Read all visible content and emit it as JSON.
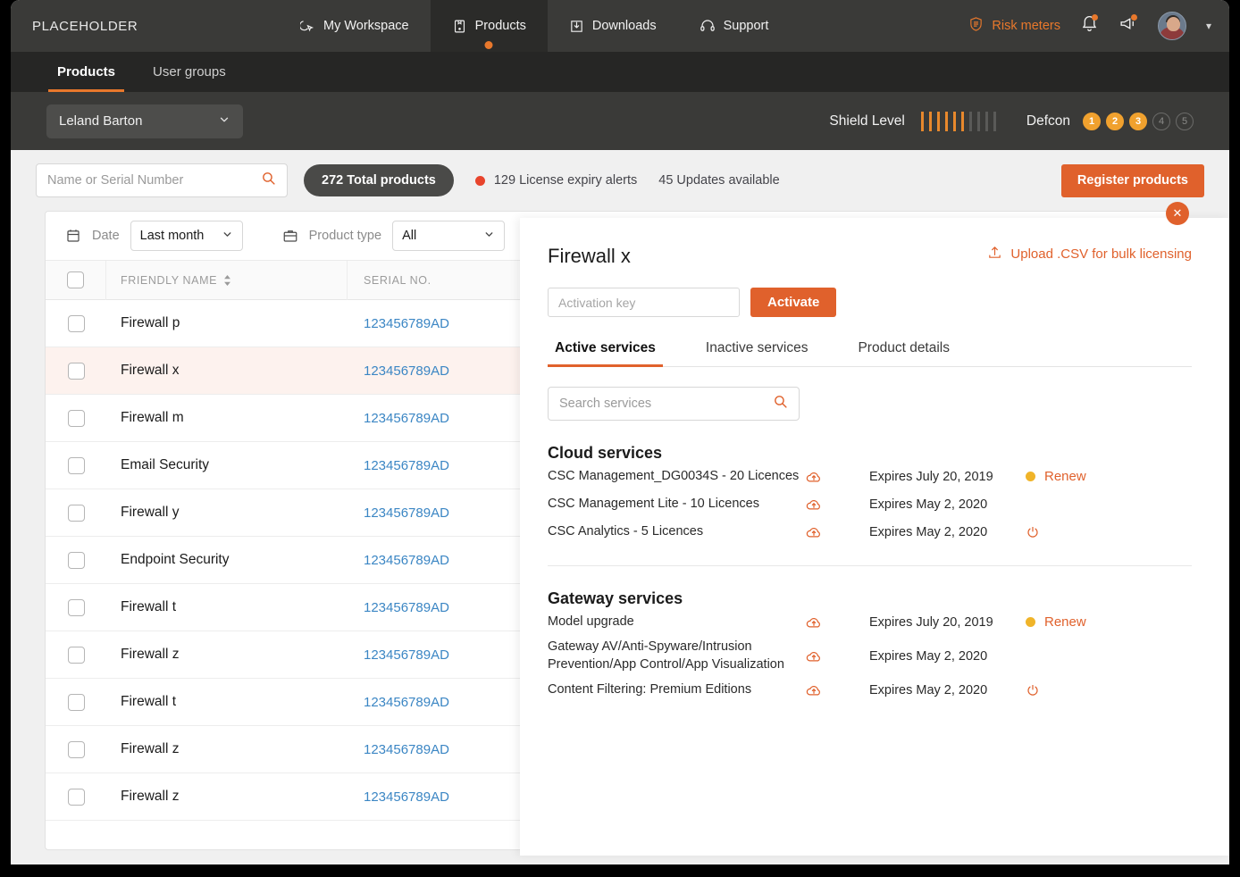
{
  "topnav": {
    "brand": "PLACEHOLDER",
    "items": [
      {
        "label": "My Workspace",
        "icon": "cursor-icon",
        "active": false
      },
      {
        "label": "Products",
        "icon": "package-icon",
        "active": true
      },
      {
        "label": "Downloads",
        "icon": "download-icon",
        "active": false
      },
      {
        "label": "Support",
        "icon": "headset-icon",
        "active": false
      }
    ],
    "risk_meters": "Risk meters",
    "icons": [
      "bell-icon",
      "megaphone-icon",
      "avatar",
      "chevron-down-icon"
    ]
  },
  "subnav": {
    "tabs": [
      {
        "label": "Products",
        "active": true
      },
      {
        "label": "User groups",
        "active": false
      }
    ]
  },
  "userband": {
    "user": "Leland Barton",
    "shield_label": "Shield Level",
    "shield_filled": 6,
    "shield_total": 10,
    "defcon_label": "Defcon",
    "defcon_levels": [
      "1",
      "2",
      "3",
      "4",
      "5"
    ],
    "defcon_active": 3
  },
  "toolbar": {
    "search_placeholder": "Name or Serial Number",
    "search_value": "",
    "total_products": "272 Total products",
    "expiry_alerts": "129 License expiry alerts",
    "updates_available": "45 Updates available",
    "register_label": "Register products"
  },
  "filters": {
    "date_label": "Date",
    "date_value": "Last month",
    "product_type_label": "Product type",
    "product_type_value": "All"
  },
  "table": {
    "columns": [
      "FRIENDLY NAME",
      "SERIAL NO."
    ],
    "rows": [
      {
        "name": "Firewall p",
        "serial": "123456789AD",
        "selected": false,
        "alert": false
      },
      {
        "name": "Firewall x",
        "serial": "123456789AD",
        "selected": true,
        "alert": true
      },
      {
        "name": "Firewall m",
        "serial": "123456789AD",
        "selected": false,
        "alert": false
      },
      {
        "name": "Email Security",
        "serial": "123456789AD",
        "selected": false,
        "alert": false
      },
      {
        "name": "Firewall y",
        "serial": "123456789AD",
        "selected": false,
        "alert": false
      },
      {
        "name": "Endpoint Security",
        "serial": "123456789AD",
        "selected": false,
        "alert": false
      },
      {
        "name": "Firewall t",
        "serial": "123456789AD",
        "selected": false,
        "alert": false
      },
      {
        "name": "Firewall z",
        "serial": "123456789AD",
        "selected": false,
        "alert": false
      },
      {
        "name": "Firewall t",
        "serial": "123456789AD",
        "selected": false,
        "alert": false
      },
      {
        "name": "Firewall z",
        "serial": "123456789AD",
        "selected": false,
        "alert": false
      },
      {
        "name": "Firewall z",
        "serial": "123456789AD",
        "selected": false,
        "alert": false
      }
    ]
  },
  "panel": {
    "title": "Firewall x",
    "upload_link": "Upload .CSV for bulk licensing",
    "activation_placeholder": "Activation key",
    "activation_value": "",
    "activate_label": "Activate",
    "tabs": [
      {
        "label": "Active services",
        "active": true
      },
      {
        "label": "Inactive services",
        "active": false
      },
      {
        "label": "Product details",
        "active": false
      }
    ],
    "search_placeholder": "Search services",
    "search_value": "",
    "groups": [
      {
        "title": "Cloud services",
        "services": [
          {
            "name": "CSC Management_DG0034S - 20 Licences",
            "expiry": "Expires July 20, 2019",
            "status": "renew",
            "action": "Renew"
          },
          {
            "name": "CSC Management Lite - 10 Licences",
            "expiry": "Expires May 2, 2020",
            "status": "none",
            "action": ""
          },
          {
            "name": "CSC Analytics - 5 Licences",
            "expiry": "Expires May 2, 2020",
            "status": "power",
            "action": ""
          }
        ]
      },
      {
        "title": "Gateway services",
        "services": [
          {
            "name": "Model upgrade",
            "expiry": "Expires July 20, 2019",
            "status": "renew",
            "action": "Renew"
          },
          {
            "name": "Gateway AV/Anti-Spyware/Intrusion Prevention/App Control/App Visualization",
            "expiry": "Expires May 2, 2020",
            "status": "none",
            "action": ""
          },
          {
            "name": "Content Filtering: Premium Editions",
            "expiry": "Expires May 2, 2020",
            "status": "power",
            "action": ""
          }
        ]
      }
    ],
    "close_label": "✕"
  },
  "colors": {
    "accent": "#e0612c",
    "accent_light": "#e8782c",
    "amber": "#f0b429",
    "red": "#e8442c",
    "link": "#3b86c4",
    "dark_nav": "#3a3a38",
    "darker_nav": "#262625"
  }
}
